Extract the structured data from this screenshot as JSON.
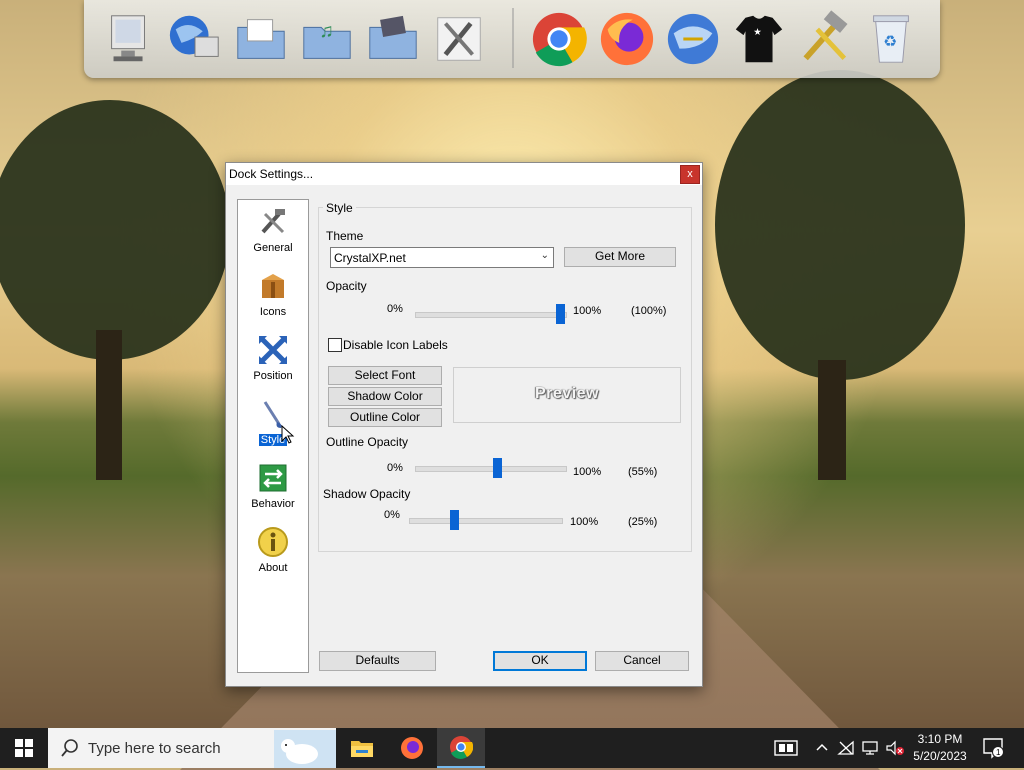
{
  "dock": {
    "items": [
      {
        "name": "my-computer"
      },
      {
        "name": "network"
      },
      {
        "name": "documents-folder"
      },
      {
        "name": "music-folder"
      },
      {
        "name": "pictures-folder"
      },
      {
        "name": "tools"
      },
      {
        "name": "chrome"
      },
      {
        "name": "firefox"
      },
      {
        "name": "internet"
      },
      {
        "name": "tshirt"
      },
      {
        "name": "hammer-tool"
      },
      {
        "name": "recycle-bin"
      }
    ]
  },
  "dialog": {
    "title": "Dock Settings...",
    "close_label": "x",
    "sidebar": [
      {
        "label": "General",
        "icon": "tools-icon"
      },
      {
        "label": "Icons",
        "icon": "box-icon"
      },
      {
        "label": "Position",
        "icon": "arrows-icon"
      },
      {
        "label": "Style",
        "icon": "brush-icon",
        "selected": true
      },
      {
        "label": "Behavior",
        "icon": "behavior-icon"
      },
      {
        "label": "About",
        "icon": "info-icon"
      }
    ],
    "style": {
      "group_title": "Style",
      "theme_label": "Theme",
      "theme_value": "CrystalXP.net",
      "get_more_label": "Get More",
      "opacity_label": "Opacity",
      "opacity_min": "0%",
      "opacity_max": "100%",
      "opacity_value": "(100%)",
      "opacity_level": 100,
      "disable_labels_text": "Disable Icon Labels",
      "disable_labels_checked": false,
      "select_font_label": "Select Font",
      "shadow_color_label": "Shadow Color",
      "outline_color_label": "Outline Color",
      "preview_text": "Preview",
      "outline_opacity_label": "Outline Opacity",
      "outline_min": "0%",
      "outline_max": "100%",
      "outline_value": "(55%)",
      "outline_level": 55,
      "shadow_opacity_label": "Shadow Opacity",
      "shadow_min": "0%",
      "shadow_max": "100%",
      "shadow_value": "(25%)",
      "shadow_level": 25
    },
    "defaults_label": "Defaults",
    "ok_label": "OK",
    "cancel_label": "Cancel"
  },
  "taskbar": {
    "search_placeholder": "Type here to search",
    "apps": [
      {
        "name": "file-explorer"
      },
      {
        "name": "firefox"
      },
      {
        "name": "chrome",
        "active": true
      }
    ],
    "time": "3:10 PM",
    "date": "5/20/2023",
    "notification_count": "1"
  }
}
